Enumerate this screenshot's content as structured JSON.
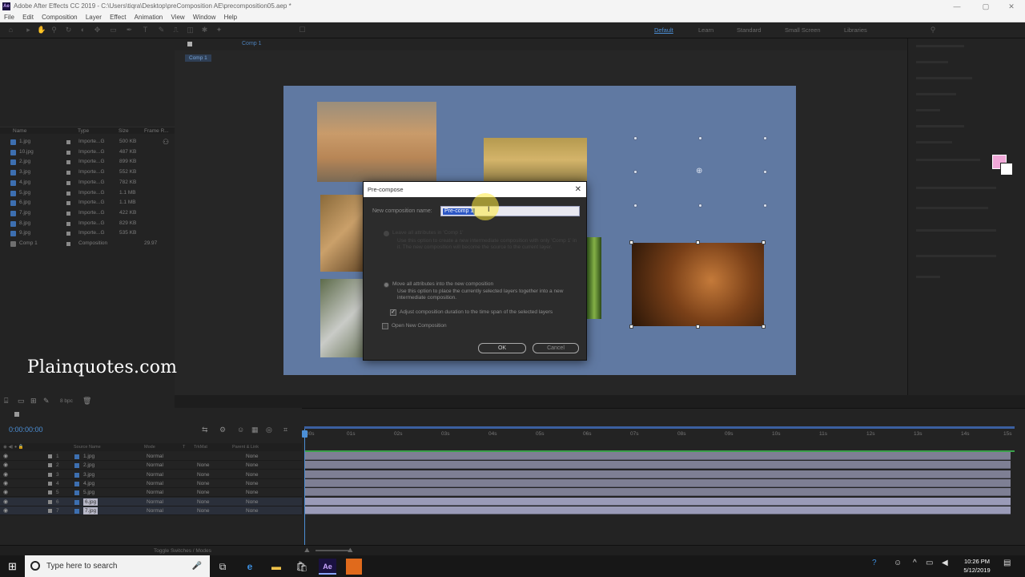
{
  "window": {
    "title": "Adobe After Effects CC 2019 - C:\\Users\\tiqra\\Desktop\\preComposition AE\\precomposition05.aep *",
    "app_icon": "Ae",
    "controls": [
      "—",
      "▢",
      "✕"
    ]
  },
  "menu": [
    "File",
    "Edit",
    "Composition",
    "Layer",
    "Effect",
    "Animation",
    "View",
    "Window",
    "Help"
  ],
  "workspaces": [
    {
      "label": "Default",
      "active": true
    },
    {
      "label": "Learn",
      "active": false
    },
    {
      "label": "Standard",
      "active": false
    },
    {
      "label": "Small Screen",
      "active": false
    },
    {
      "label": "Libraries",
      "active": false
    }
  ],
  "project": {
    "columns": [
      "Name",
      "Type",
      "Size",
      "Frame R..."
    ],
    "items": [
      {
        "name": "1.jpg",
        "type": "Importe...G",
        "size": "500 KB",
        "frame_rate": "",
        "kind": "file"
      },
      {
        "name": "10.jpg",
        "type": "Importe...G",
        "size": "487 KB",
        "frame_rate": "",
        "kind": "file"
      },
      {
        "name": "2.jpg",
        "type": "Importe...G",
        "size": "899 KB",
        "frame_rate": "",
        "kind": "file"
      },
      {
        "name": "3.jpg",
        "type": "Importe...G",
        "size": "552 KB",
        "frame_rate": "",
        "kind": "file"
      },
      {
        "name": "4.jpg",
        "type": "Importe...G",
        "size": "782 KB",
        "frame_rate": "",
        "kind": "file"
      },
      {
        "name": "5.jpg",
        "type": "Importe...G",
        "size": "1.1 MB",
        "frame_rate": "",
        "kind": "file"
      },
      {
        "name": "6.jpg",
        "type": "Importe...G",
        "size": "1.1 MB",
        "frame_rate": "",
        "kind": "file"
      },
      {
        "name": "7.jpg",
        "type": "Importe...G",
        "size": "422 KB",
        "frame_rate": "",
        "kind": "file"
      },
      {
        "name": "8.jpg",
        "type": "Importe...G",
        "size": "829 KB",
        "frame_rate": "",
        "kind": "file"
      },
      {
        "name": "9.jpg",
        "type": "Importe...G",
        "size": "535 KB",
        "frame_rate": "",
        "kind": "file"
      },
      {
        "name": "Comp 1",
        "type": "Composition",
        "size": "",
        "frame_rate": "29.97",
        "kind": "comp"
      }
    ],
    "footer_bpc": "8 bpc"
  },
  "viewer": {
    "comp_tab": "Comp 1",
    "sub_tab": "Comp 1"
  },
  "watermark": "Plainquotes.com",
  "dialog": {
    "title": "Pre-compose",
    "close": "✕",
    "name_label": "New composition name:",
    "name_value": "Pre-comp 1",
    "option1_label": "Leave all attributes in 'Comp 1'",
    "option1_desc": "Use this option to create a new intermediate composition with only 'Comp 1' in it. The new composition will become the source to the current layer.",
    "option2_label": "Move all attributes into the new composition",
    "option2_desc": "Use this option to place the currently selected layers together into a new intermediate composition.",
    "adjust_label": "Adjust composition duration to the time span of the selected layers",
    "adjust_checked": true,
    "open_label": "Open New Composition",
    "open_checked": false,
    "ok": "OK",
    "cancel": "Cancel"
  },
  "timeline": {
    "timecode": "0:00:00:00",
    "columns": [
      "Source Name",
      "Mode",
      "T",
      "TrkMat",
      "Parent & Link"
    ],
    "layers": [
      {
        "num": "1",
        "name": "1.jpg",
        "mode": "Normal",
        "trkmat": "",
        "parent": "None",
        "selected": false
      },
      {
        "num": "2",
        "name": "2.jpg",
        "mode": "Normal",
        "trkmat": "None",
        "parent": "None",
        "selected": false
      },
      {
        "num": "3",
        "name": "3.jpg",
        "mode": "Normal",
        "trkmat": "None",
        "parent": "None",
        "selected": false
      },
      {
        "num": "4",
        "name": "4.jpg",
        "mode": "Normal",
        "trkmat": "None",
        "parent": "None",
        "selected": false
      },
      {
        "num": "5",
        "name": "5.jpg",
        "mode": "Normal",
        "trkmat": "None",
        "parent": "None",
        "selected": false
      },
      {
        "num": "6",
        "name": "6.jpg",
        "mode": "Normal",
        "trkmat": "None",
        "parent": "None",
        "selected": true
      },
      {
        "num": "7",
        "name": "7.jpg",
        "mode": "Normal",
        "trkmat": "None",
        "parent": "None",
        "selected": true
      }
    ],
    "ruler": [
      "00s",
      "01s",
      "02s",
      "03s",
      "04s",
      "05s",
      "06s",
      "07s",
      "08s",
      "09s",
      "10s",
      "11s",
      "12s",
      "13s",
      "14s",
      "15s"
    ],
    "footer": "Toggle Switches / Modes"
  },
  "taskbar": {
    "search_placeholder": "Type here to search",
    "time": "10:26 PM",
    "date": "5/12/2019"
  }
}
